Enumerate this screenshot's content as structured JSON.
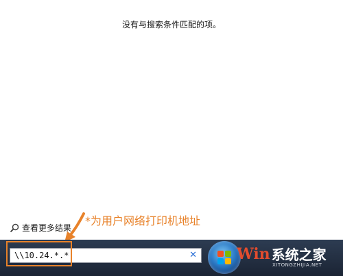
{
  "results": {
    "message": "没有与搜索条件匹配的项。"
  },
  "see_more": {
    "label": "查看更多结果",
    "icon": "search-icon"
  },
  "annotation": {
    "text": "*为用户网络打印机地址",
    "color": "#e8822a"
  },
  "search": {
    "value": "\\\\10.24.*.*",
    "clear_icon": "close-icon"
  },
  "start_button": {
    "icon": "windows-logo-icon"
  },
  "watermark": {
    "win": "Win",
    "text": "系统之家",
    "url": "XITONGZHIJIA.NET"
  }
}
